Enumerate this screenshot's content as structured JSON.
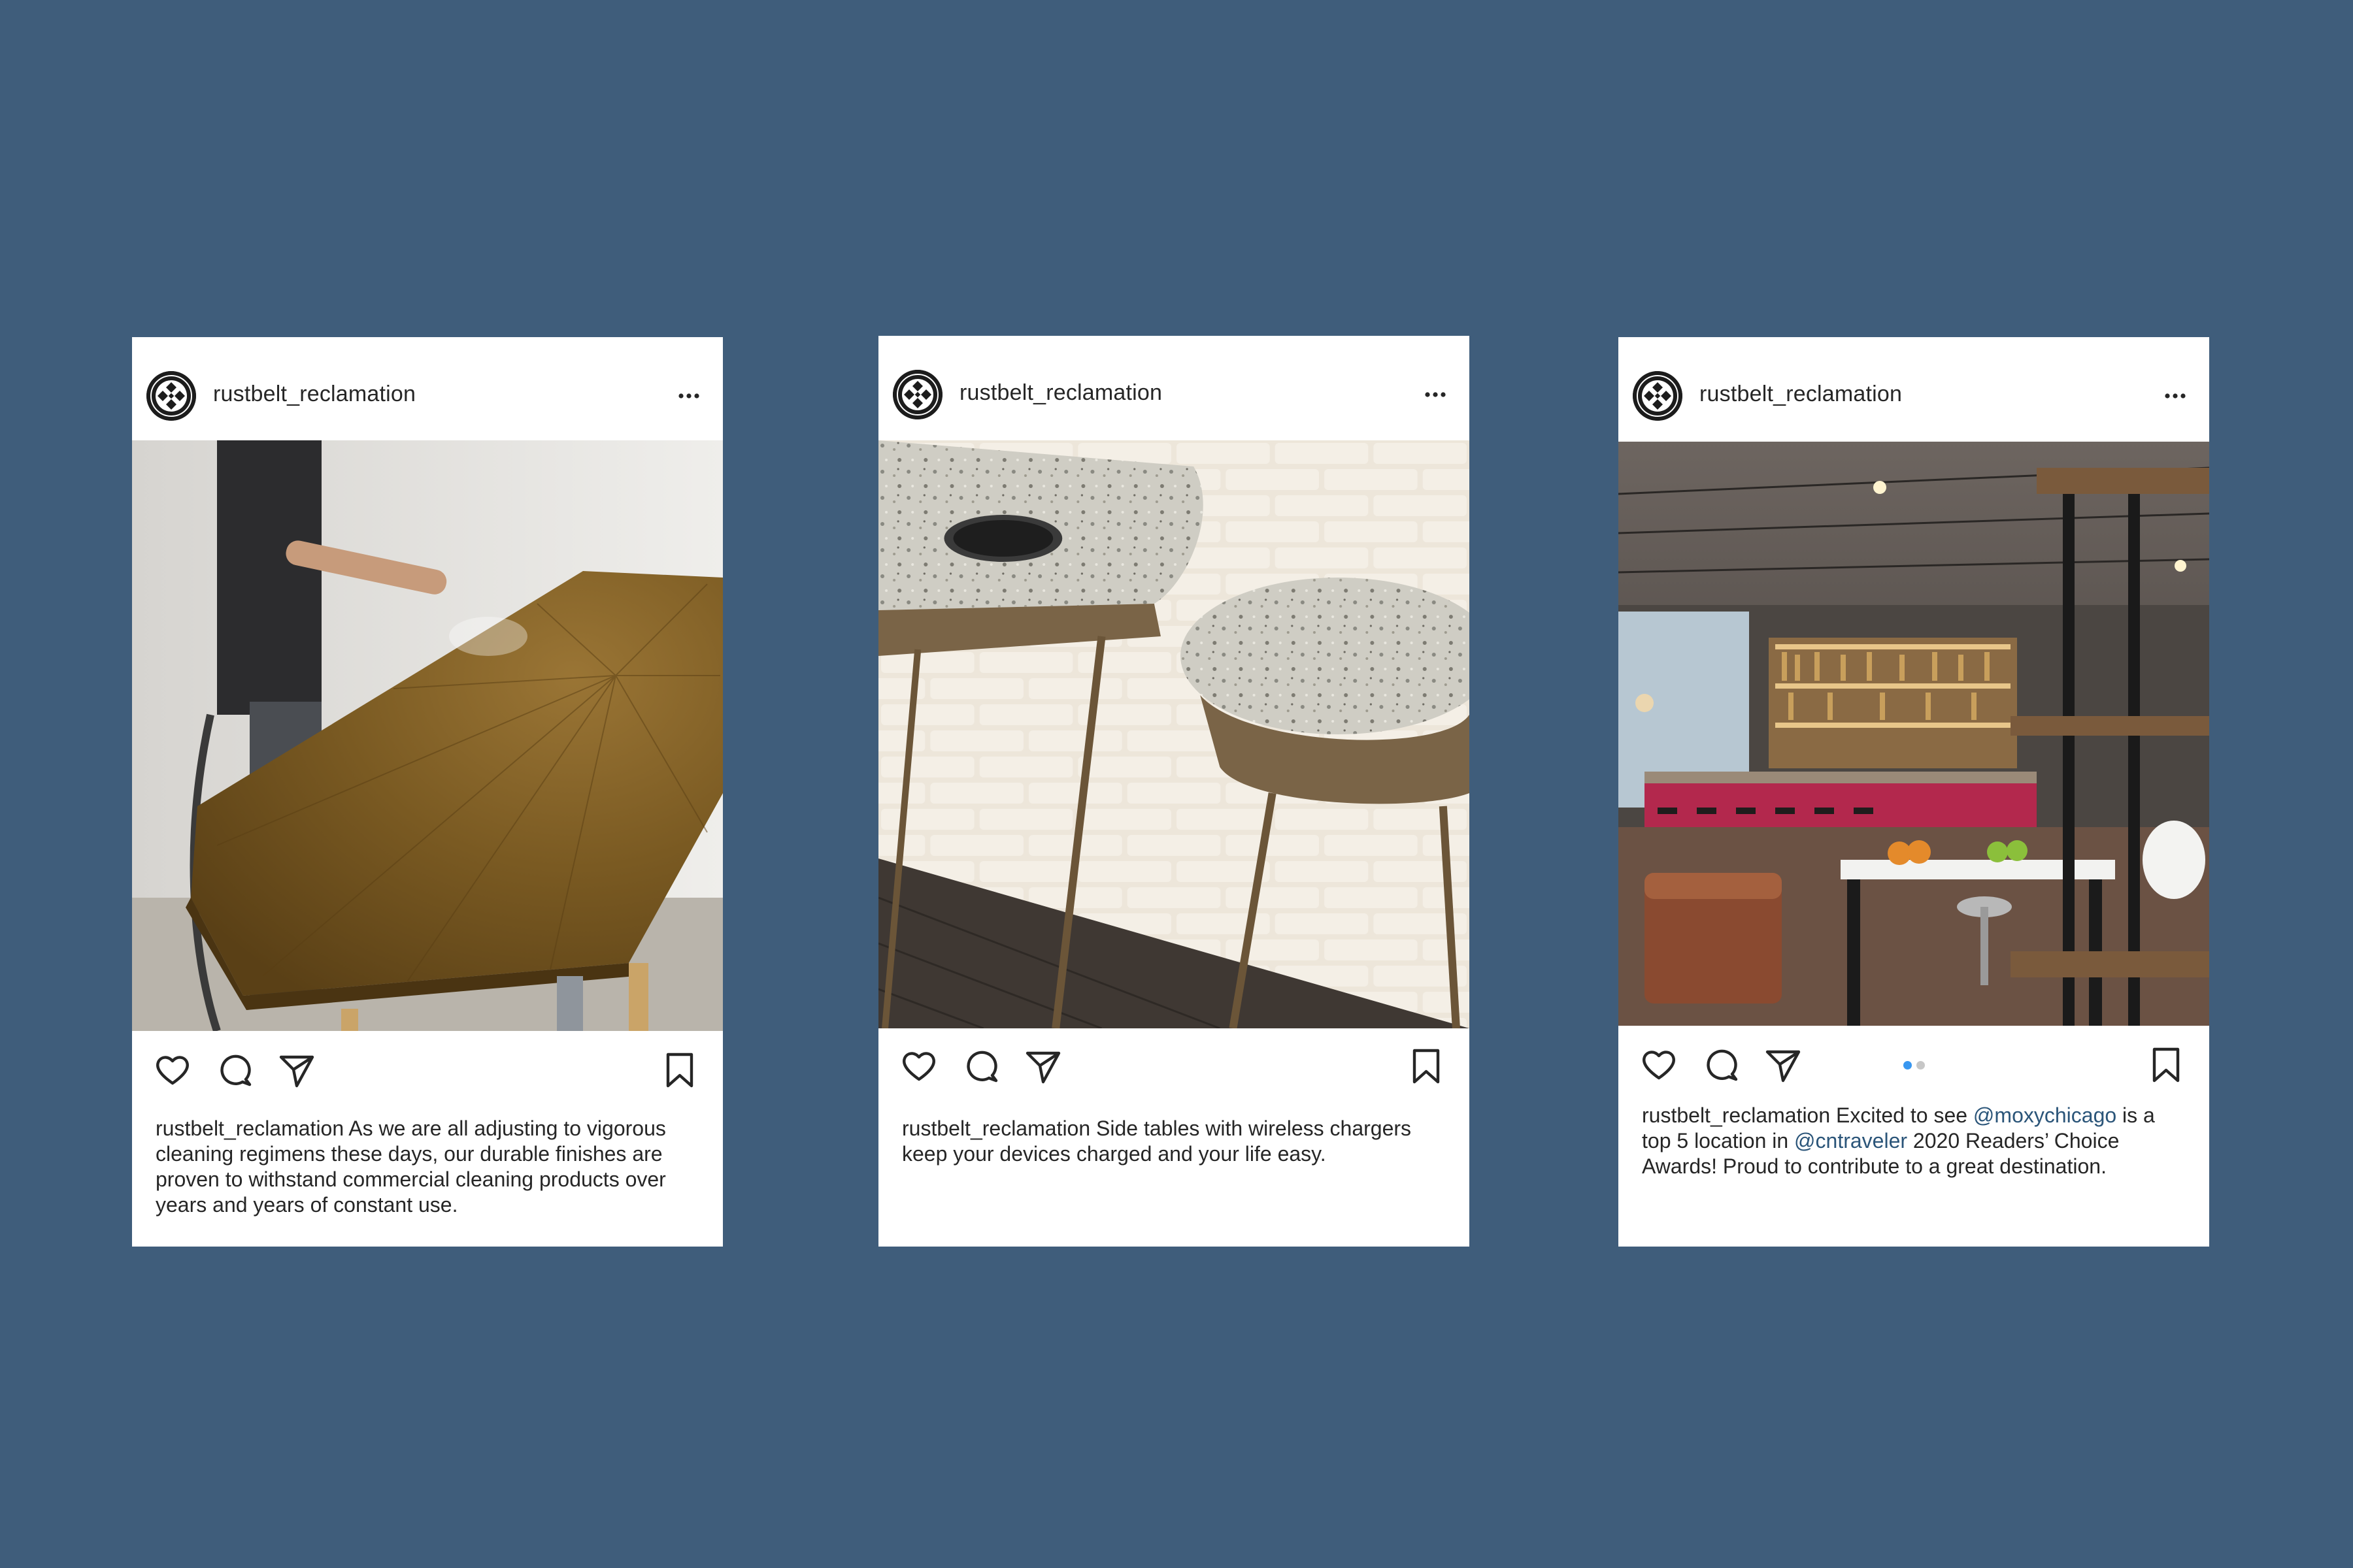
{
  "background_color": "#3f5d7b",
  "posts": [
    {
      "username": "rustbelt_reclamation",
      "image_description": "person-spraying-wood-table",
      "caption_user": "rustbelt_reclamation",
      "caption_text": "As we are all adjusting to vigorous cleaning regimens these days, our durable finishes are proven to withstand commercial cleaning products over years and years of constant use."
    },
    {
      "username": "rustbelt_reclamation",
      "image_description": "terrazzo-side-tables-wireless-charger",
      "caption_user": "rustbelt_reclamation",
      "caption_text": "Side tables with wireless chargers keep your devices charged and your life easy."
    },
    {
      "username": "rustbelt_reclamation",
      "image_description": "hotel-bar-interior",
      "caption_user": "rustbelt_reclamation",
      "caption_parts": {
        "t1": "Excited to see",
        "m1": "@moxychicago",
        "t2": "is a top 5 location in",
        "m2": "@cntraveler",
        "t3": "2020 Readers’ Choice Awards! Proud to contribute to a great destination."
      },
      "carousel": {
        "count": 2,
        "active": 1,
        "active_color": "#3897f0",
        "inactive_color": "#c7c7c7"
      }
    }
  ],
  "icons": {
    "more": "more-horizontal-icon",
    "like": "heart-icon",
    "comment": "comment-bubble-icon",
    "share": "paper-plane-icon",
    "save": "bookmark-icon"
  },
  "colors": {
    "text": "#262626",
    "mention": "#2b5579",
    "card": "#ffffff"
  }
}
